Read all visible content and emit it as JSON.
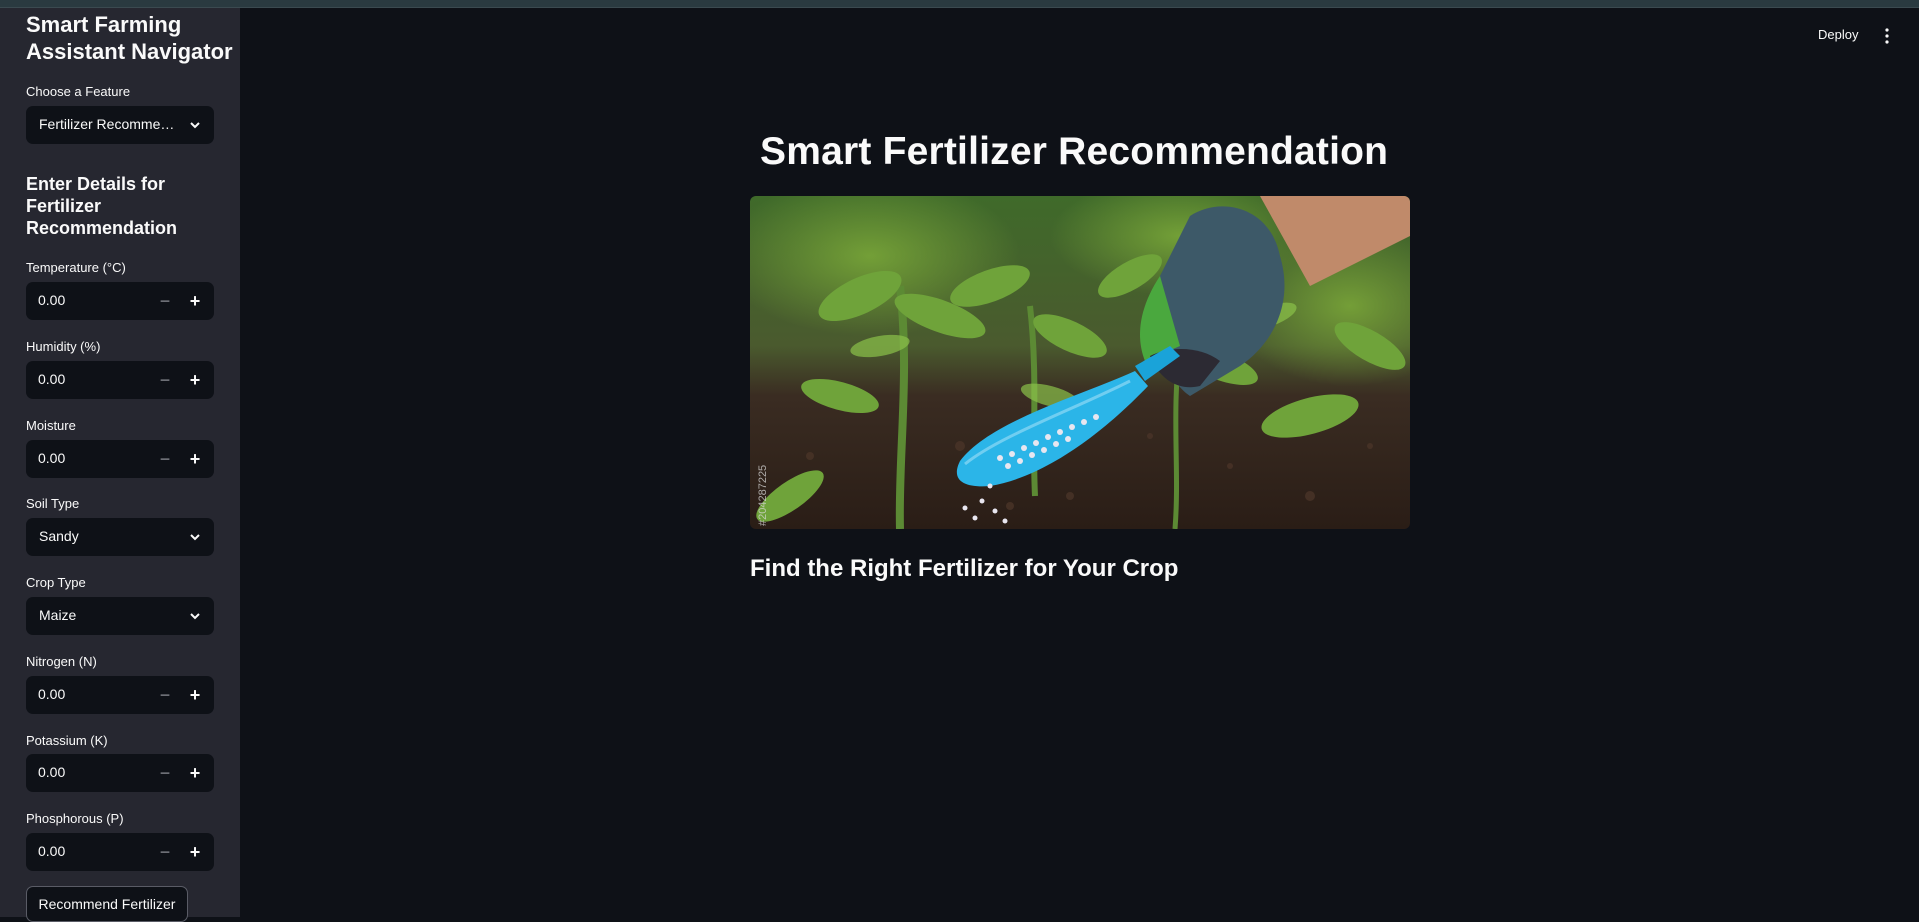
{
  "sidebar": {
    "title": "Smart Farming Assistant Navigator",
    "feature_label": "Choose a Feature",
    "feature_value": "Fertilizer Recommendation",
    "section_title": "Enter Details for Fertilizer Recommendation",
    "fields": {
      "temperature": {
        "label": "Temperature (°C)",
        "value": "0.00"
      },
      "humidity": {
        "label": "Humidity (%)",
        "value": "0.00"
      },
      "moisture": {
        "label": "Moisture",
        "value": "0.00"
      },
      "soil": {
        "label": "Soil Type",
        "value": "Sandy"
      },
      "crop": {
        "label": "Crop Type",
        "value": "Maize"
      },
      "nitrogen": {
        "label": "Nitrogen (N)",
        "value": "0.00"
      },
      "potassium": {
        "label": "Potassium (K)",
        "value": "0.00"
      },
      "phosphorous": {
        "label": "Phosphorous (P)",
        "value": "0.00"
      }
    },
    "stepper_minus": "−",
    "stepper_plus": "+",
    "submit_label": "Recommend Fertilizer"
  },
  "header": {
    "deploy_label": "Deploy"
  },
  "main": {
    "title": "Smart Fertilizer Recommendation",
    "image_watermark": "#204287225",
    "subheader": "Find the Right Fertilizer for Your Crop"
  },
  "colors": {
    "background": "#0e1117",
    "sidebar": "#262730",
    "input": "#0e1117",
    "text": "#fafafa"
  },
  "icons": [
    "chevron-down-icon",
    "minus-icon",
    "plus-icon",
    "kebab-menu-icon"
  ]
}
